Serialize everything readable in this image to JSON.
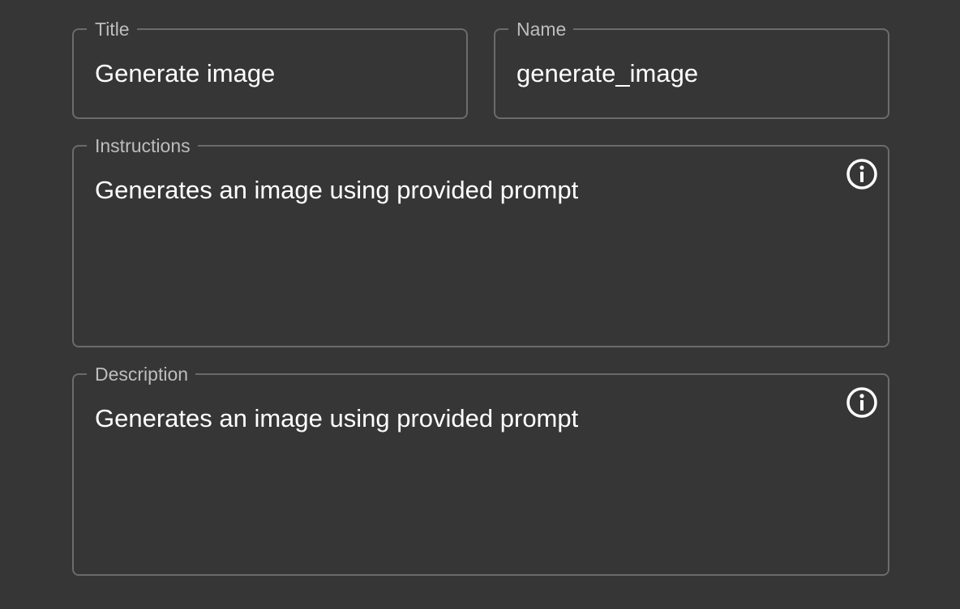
{
  "form": {
    "title": {
      "label": "Title",
      "value": "Generate image"
    },
    "name": {
      "label": "Name",
      "value": "generate_image"
    },
    "instructions": {
      "label": "Instructions",
      "value": "Generates an image using provided prompt",
      "icon": "info-icon"
    },
    "description": {
      "label": "Description",
      "value": "Generates an image using provided prompt",
      "icon": "info-icon"
    }
  },
  "colors": {
    "background": "#363636",
    "border": "#6b6b6b",
    "label": "#bdbdbd",
    "text": "#ffffff"
  }
}
